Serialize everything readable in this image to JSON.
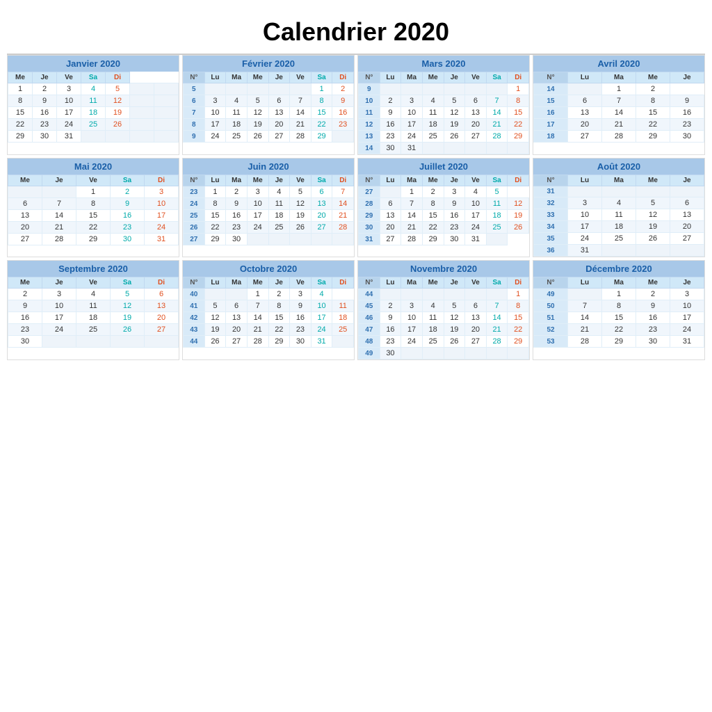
{
  "title": "Calendrier 2020",
  "months": [
    {
      "name": "Janvier 2020",
      "headers": [
        "Me",
        "Je",
        "Ve",
        "Sa",
        "Di"
      ],
      "hasWeekNum": false,
      "firstCol": "Me",
      "weeks": [
        {
          "wn": null,
          "days": [
            "1",
            "2",
            "3",
            "4",
            "5",
            "",
            ""
          ]
        },
        {
          "wn": null,
          "days": [
            "8",
            "9",
            "10",
            "11",
            "12",
            "",
            ""
          ]
        },
        {
          "wn": null,
          "days": [
            "15",
            "16",
            "17",
            "18",
            "19",
            "",
            ""
          ]
        },
        {
          "wn": null,
          "days": [
            "22",
            "23",
            "24",
            "25",
            "26",
            "",
            ""
          ]
        },
        {
          "wn": null,
          "days": [
            "29",
            "30",
            "31",
            "",
            "",
            "",
            ""
          ]
        }
      ]
    },
    {
      "name": "Février 2020",
      "headers": [
        "N°",
        "Lu",
        "Ma",
        "Me",
        "Je",
        "Ve",
        "Sa",
        "Di"
      ],
      "weeks": [
        {
          "wn": "5",
          "days": [
            "",
            "",
            "",
            "",
            "",
            "1",
            "2"
          ]
        },
        {
          "wn": "6",
          "days": [
            "3",
            "4",
            "5",
            "6",
            "7",
            "8",
            "9"
          ]
        },
        {
          "wn": "7",
          "days": [
            "10",
            "11",
            "12",
            "13",
            "14",
            "15",
            "16"
          ]
        },
        {
          "wn": "8",
          "days": [
            "17",
            "18",
            "19",
            "20",
            "21",
            "22",
            "23"
          ]
        },
        {
          "wn": "9",
          "days": [
            "24",
            "25",
            "26",
            "27",
            "28",
            "29",
            ""
          ]
        }
      ]
    },
    {
      "name": "Mars 2020",
      "headers": [
        "N°",
        "Lu",
        "Ma",
        "Me",
        "Je",
        "Ve",
        "Sa",
        "Di"
      ],
      "weeks": [
        {
          "wn": "9",
          "days": [
            "",
            "",
            "",
            "",
            "",
            "",
            "1"
          ]
        },
        {
          "wn": "10",
          "days": [
            "2",
            "3",
            "4",
            "5",
            "6",
            "7",
            "8"
          ]
        },
        {
          "wn": "11",
          "days": [
            "9",
            "10",
            "11",
            "12",
            "13",
            "14",
            "15"
          ]
        },
        {
          "wn": "12",
          "days": [
            "16",
            "17",
            "18",
            "19",
            "20",
            "21",
            "22"
          ]
        },
        {
          "wn": "13",
          "days": [
            "23",
            "24",
            "25",
            "26",
            "27",
            "28",
            "29"
          ]
        },
        {
          "wn": "14",
          "days": [
            "30",
            "31",
            "",
            "",
            "",
            "",
            ""
          ]
        }
      ]
    },
    {
      "name": "Avril 2020",
      "headers": [
        "N°",
        "Lu",
        "Ma",
        "Me",
        "Je"
      ],
      "partial": true,
      "weeks": [
        {
          "wn": "14",
          "days": [
            "",
            "1",
            "2"
          ]
        },
        {
          "wn": "15",
          "days": [
            "6",
            "7",
            "8",
            "9"
          ]
        },
        {
          "wn": "16",
          "days": [
            "13",
            "14",
            "15",
            "16"
          ]
        },
        {
          "wn": "17",
          "days": [
            "20",
            "21",
            "22",
            "23"
          ]
        },
        {
          "wn": "18",
          "days": [
            "27",
            "28",
            "29",
            "30"
          ]
        }
      ]
    },
    {
      "name": "Mai 2020",
      "headers": [
        "Me",
        "Je",
        "Ve",
        "Sa",
        "Di"
      ],
      "hasWeekNum": false,
      "weeks": [
        {
          "wn": null,
          "days": [
            "",
            "",
            "1",
            "2",
            "3"
          ]
        },
        {
          "wn": null,
          "days": [
            "6",
            "7",
            "8",
            "9",
            "10"
          ]
        },
        {
          "wn": null,
          "days": [
            "13",
            "14",
            "15",
            "16",
            "17"
          ]
        },
        {
          "wn": null,
          "days": [
            "20",
            "21",
            "22",
            "23",
            "24"
          ]
        },
        {
          "wn": null,
          "days": [
            "27",
            "28",
            "29",
            "30",
            "31"
          ]
        }
      ]
    },
    {
      "name": "Juin 2020",
      "headers": [
        "N°",
        "Lu",
        "Ma",
        "Me",
        "Je",
        "Ve",
        "Sa",
        "Di"
      ],
      "weeks": [
        {
          "wn": "23",
          "days": [
            "1",
            "2",
            "3",
            "4",
            "5",
            "6",
            "7"
          ]
        },
        {
          "wn": "24",
          "days": [
            "8",
            "9",
            "10",
            "11",
            "12",
            "13",
            "14"
          ]
        },
        {
          "wn": "25",
          "days": [
            "15",
            "16",
            "17",
            "18",
            "19",
            "20",
            "21"
          ]
        },
        {
          "wn": "26",
          "days": [
            "22",
            "23",
            "24",
            "25",
            "26",
            "27",
            "28"
          ]
        },
        {
          "wn": "27",
          "days": [
            "29",
            "30",
            "",
            "",
            "",
            "",
            ""
          ]
        }
      ]
    },
    {
      "name": "Juillet 2020",
      "headers": [
        "N°",
        "Lu",
        "Ma",
        "Me",
        "Je",
        "Ve",
        "Sa",
        "Di"
      ],
      "weeks": [
        {
          "wn": "27",
          "days": [
            "",
            "1",
            "2",
            "3",
            "4",
            "5"
          ]
        },
        {
          "wn": "28",
          "days": [
            "6",
            "7",
            "8",
            "9",
            "10",
            "11",
            "12"
          ]
        },
        {
          "wn": "29",
          "days": [
            "13",
            "14",
            "15",
            "16",
            "17",
            "18",
            "19"
          ]
        },
        {
          "wn": "30",
          "days": [
            "20",
            "21",
            "22",
            "23",
            "24",
            "25",
            "26"
          ]
        },
        {
          "wn": "31",
          "days": [
            "27",
            "28",
            "29",
            "30",
            "31",
            ""
          ]
        }
      ]
    },
    {
      "name": "Août 2020",
      "headers": [
        "N°",
        "Lu",
        "Ma",
        "Me",
        "Je"
      ],
      "partial": true,
      "weeks": [
        {
          "wn": "31",
          "days": [
            "",
            "",
            "",
            ""
          ]
        },
        {
          "wn": "32",
          "days": [
            "3",
            "4",
            "5",
            "6"
          ]
        },
        {
          "wn": "33",
          "days": [
            "10",
            "11",
            "12",
            "13"
          ]
        },
        {
          "wn": "34",
          "days": [
            "17",
            "18",
            "19",
            "20"
          ]
        },
        {
          "wn": "35",
          "days": [
            "24",
            "25",
            "26",
            "27"
          ]
        },
        {
          "wn": "36",
          "days": [
            "31",
            "",
            "",
            ""
          ]
        }
      ]
    },
    {
      "name": "Septembre 2020",
      "headers": [
        "Me",
        "Je",
        "Ve",
        "Sa",
        "Di"
      ],
      "hasWeekNum": false,
      "weeks": [
        {
          "wn": null,
          "days": [
            "2",
            "3",
            "4",
            "5",
            "6"
          ]
        },
        {
          "wn": null,
          "days": [
            "9",
            "10",
            "11",
            "12",
            "13"
          ]
        },
        {
          "wn": null,
          "days": [
            "16",
            "17",
            "18",
            "19",
            "20"
          ]
        },
        {
          "wn": null,
          "days": [
            "23",
            "24",
            "25",
            "26",
            "27"
          ]
        },
        {
          "wn": null,
          "days": [
            "30",
            "",
            "",
            "",
            ""
          ]
        }
      ]
    },
    {
      "name": "Octobre 2020",
      "headers": [
        "N°",
        "Lu",
        "Ma",
        "Me",
        "Je",
        "Ve",
        "Sa",
        "Di"
      ],
      "weeks": [
        {
          "wn": "40",
          "days": [
            "",
            "",
            "1",
            "2",
            "3",
            "4"
          ]
        },
        {
          "wn": "41",
          "days": [
            "5",
            "6",
            "7",
            "8",
            "9",
            "10",
            "11"
          ]
        },
        {
          "wn": "42",
          "days": [
            "12",
            "13",
            "14",
            "15",
            "16",
            "17",
            "18"
          ]
        },
        {
          "wn": "43",
          "days": [
            "19",
            "20",
            "21",
            "22",
            "23",
            "24",
            "25"
          ]
        },
        {
          "wn": "44",
          "days": [
            "26",
            "27",
            "28",
            "29",
            "30",
            "31",
            ""
          ]
        }
      ]
    },
    {
      "name": "Novembre 2020",
      "headers": [
        "N°",
        "Lu",
        "Ma",
        "Me",
        "Je",
        "Ve",
        "Sa",
        "Di"
      ],
      "weeks": [
        {
          "wn": "44",
          "days": [
            "",
            "",
            "",
            "",
            "",
            "",
            "1"
          ]
        },
        {
          "wn": "45",
          "days": [
            "2",
            "3",
            "4",
            "5",
            "6",
            "7",
            "8"
          ]
        },
        {
          "wn": "46",
          "days": [
            "9",
            "10",
            "11",
            "12",
            "13",
            "14",
            "15"
          ]
        },
        {
          "wn": "47",
          "days": [
            "16",
            "17",
            "18",
            "19",
            "20",
            "21",
            "22"
          ]
        },
        {
          "wn": "48",
          "days": [
            "23",
            "24",
            "25",
            "26",
            "27",
            "28",
            "29"
          ]
        },
        {
          "wn": "49",
          "days": [
            "30",
            "",
            "",
            "",
            "",
            "",
            ""
          ]
        }
      ]
    },
    {
      "name": "Décembre 2020",
      "headers": [
        "N°",
        "Lu",
        "Ma",
        "Me",
        "Je"
      ],
      "partial": true,
      "weeks": [
        {
          "wn": "49",
          "days": [
            "",
            "1",
            "2",
            "3"
          ]
        },
        {
          "wn": "50",
          "days": [
            "7",
            "8",
            "9",
            "10"
          ]
        },
        {
          "wn": "51",
          "days": [
            "14",
            "15",
            "16",
            "17"
          ]
        },
        {
          "wn": "52",
          "days": [
            "21",
            "22",
            "23",
            "24"
          ]
        },
        {
          "wn": "53",
          "days": [
            "28",
            "29",
            "30",
            "31"
          ]
        }
      ]
    }
  ]
}
